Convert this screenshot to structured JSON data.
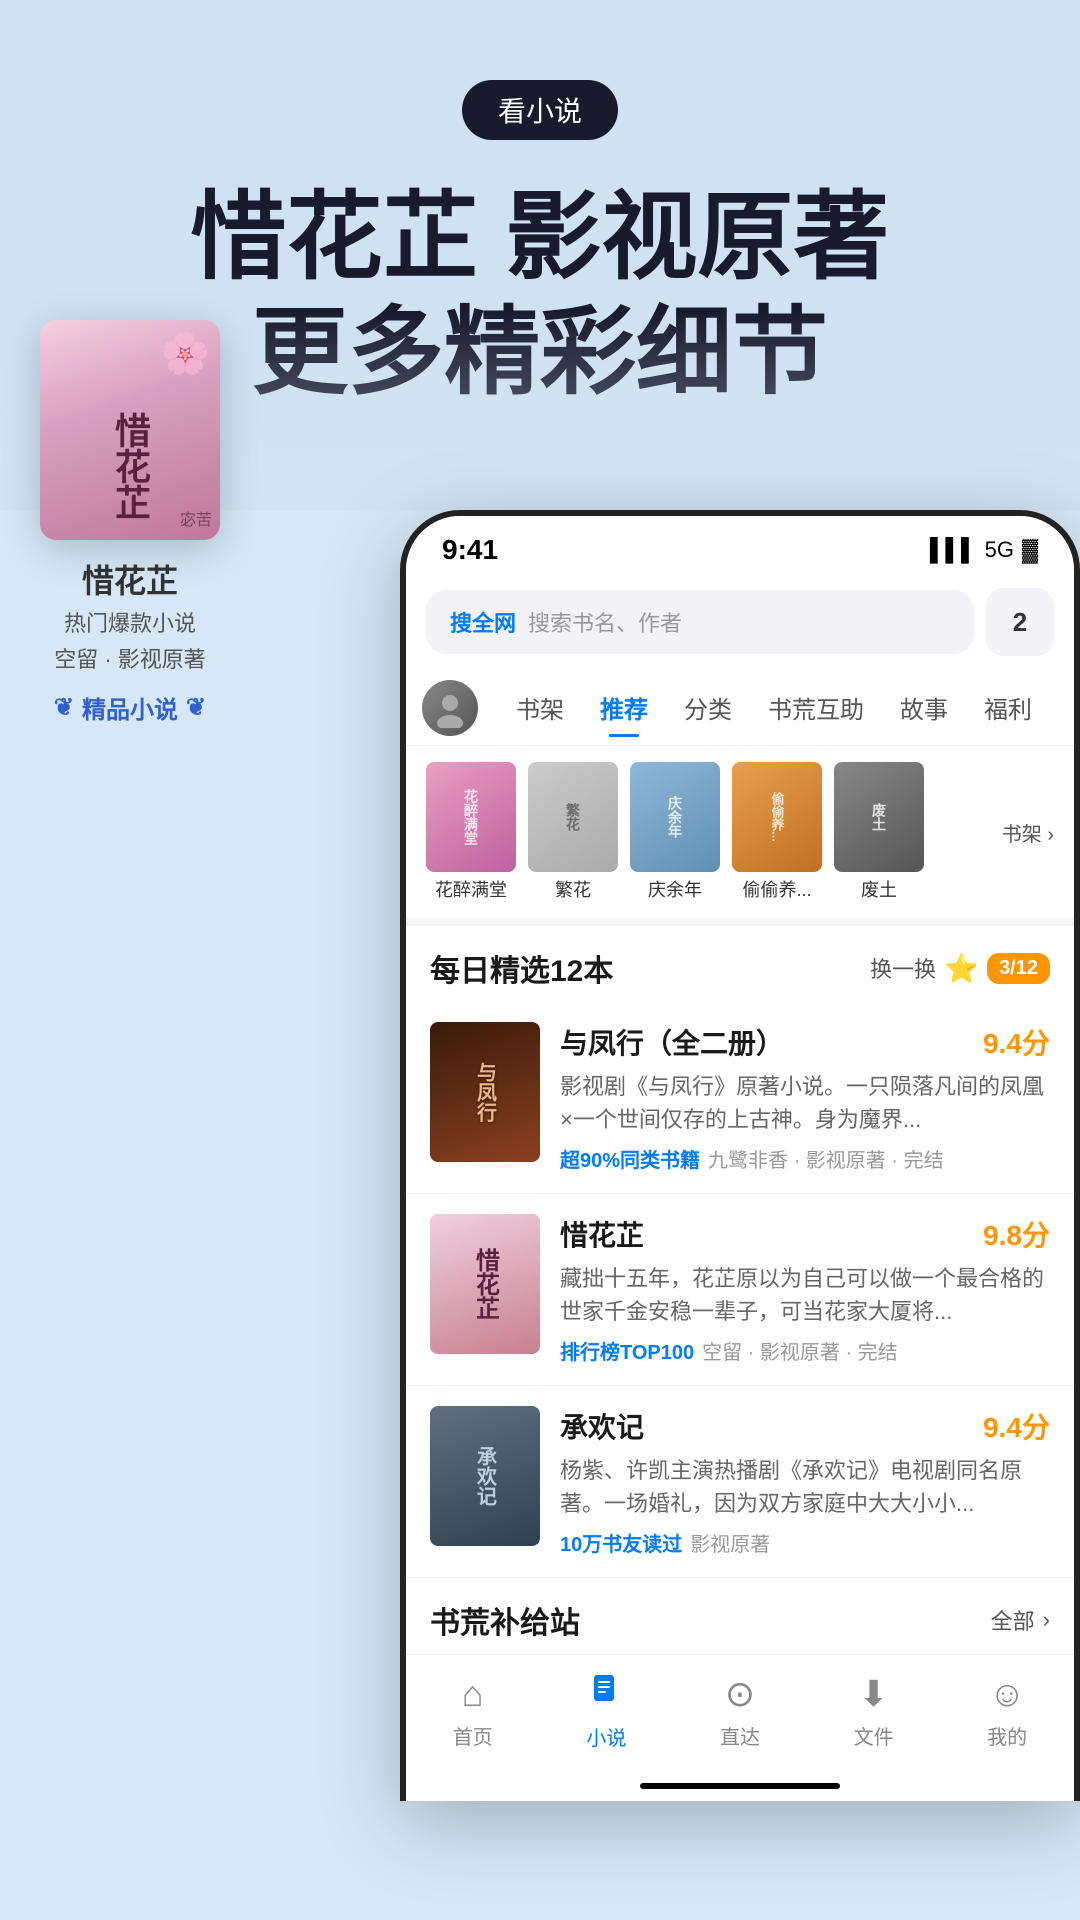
{
  "app": {
    "tag": "看小说",
    "headline_line1": "惜花芷 影视原著",
    "headline_line2": "更多精彩细节"
  },
  "status_bar": {
    "time": "9:41",
    "signal": "▌▌▌",
    "network": "5G",
    "battery": "🔋"
  },
  "search": {
    "label": "搜全网",
    "placeholder": "搜索书名、作者",
    "btn_label": "2"
  },
  "nav_tabs": [
    {
      "label": "书架",
      "active": false
    },
    {
      "label": "推荐",
      "active": true
    },
    {
      "label": "分类",
      "active": false
    },
    {
      "label": "书荒互助",
      "active": false
    },
    {
      "label": "故事",
      "active": false
    },
    {
      "label": "福利",
      "active": false
    }
  ],
  "bookshelf_books": [
    {
      "label": "花醉满堂",
      "color": "thumb-1"
    },
    {
      "label": "繁花",
      "color": "thumb-2"
    },
    {
      "label": "庆余年",
      "color": "thumb-3"
    },
    {
      "label": "偷偷养...",
      "color": "thumb-4"
    },
    {
      "label": "废土",
      "color": "thumb-5"
    }
  ],
  "bookshelf_link": "书架",
  "daily_section": {
    "title": "每日精选12本",
    "action_label": "换一换",
    "page_label": "3/12"
  },
  "books": [
    {
      "title": "与凤行（全二册）",
      "score": "9.4分",
      "desc": "影视剧《与凤行》原著小说。一只陨落凡间的凤凰×一个世间仅存的上古神。身为魔界......",
      "tag1": "超90%同类书籍",
      "tag2": "九鹭非香 · 影视原著 · 完结",
      "cover_style": "cover-1"
    },
    {
      "title": "惜花芷",
      "score": "9.8分",
      "desc": "藏拙十五年，花芷原以为自己可以做一个最合格的世家千金安稳一辈子，可当花家大厦将......",
      "tag1": "排行榜TOP100",
      "tag2": "空留 · 影视原著 · 完结",
      "cover_style": "cover-2"
    },
    {
      "title": "承欢记",
      "score": "9.4分",
      "desc": "杨紫、许凯主演热播剧《承欢记》电视剧同名原著。一场婚礼，因为双方家庭中大大小小......",
      "tag1": "10万书友读过",
      "tag2": "影视原著",
      "cover_style": "cover-3"
    }
  ],
  "supply_section": {
    "title": "书荒补给站",
    "action_label": "全部"
  },
  "left_book": {
    "title": "惜花芷",
    "subtitle": "热门爆款小说",
    "subtitle2": "空留 · 影视原著",
    "badge": "精品小说"
  },
  "bottom_nav": [
    {
      "label": "首页",
      "icon": "⌂",
      "active": false
    },
    {
      "label": "小说",
      "icon": "📖",
      "active": true
    },
    {
      "label": "直达",
      "icon": "🔍",
      "active": false
    },
    {
      "label": "文件",
      "icon": "⬇",
      "active": false
    },
    {
      "label": "我的",
      "icon": "😊",
      "active": false
    }
  ]
}
